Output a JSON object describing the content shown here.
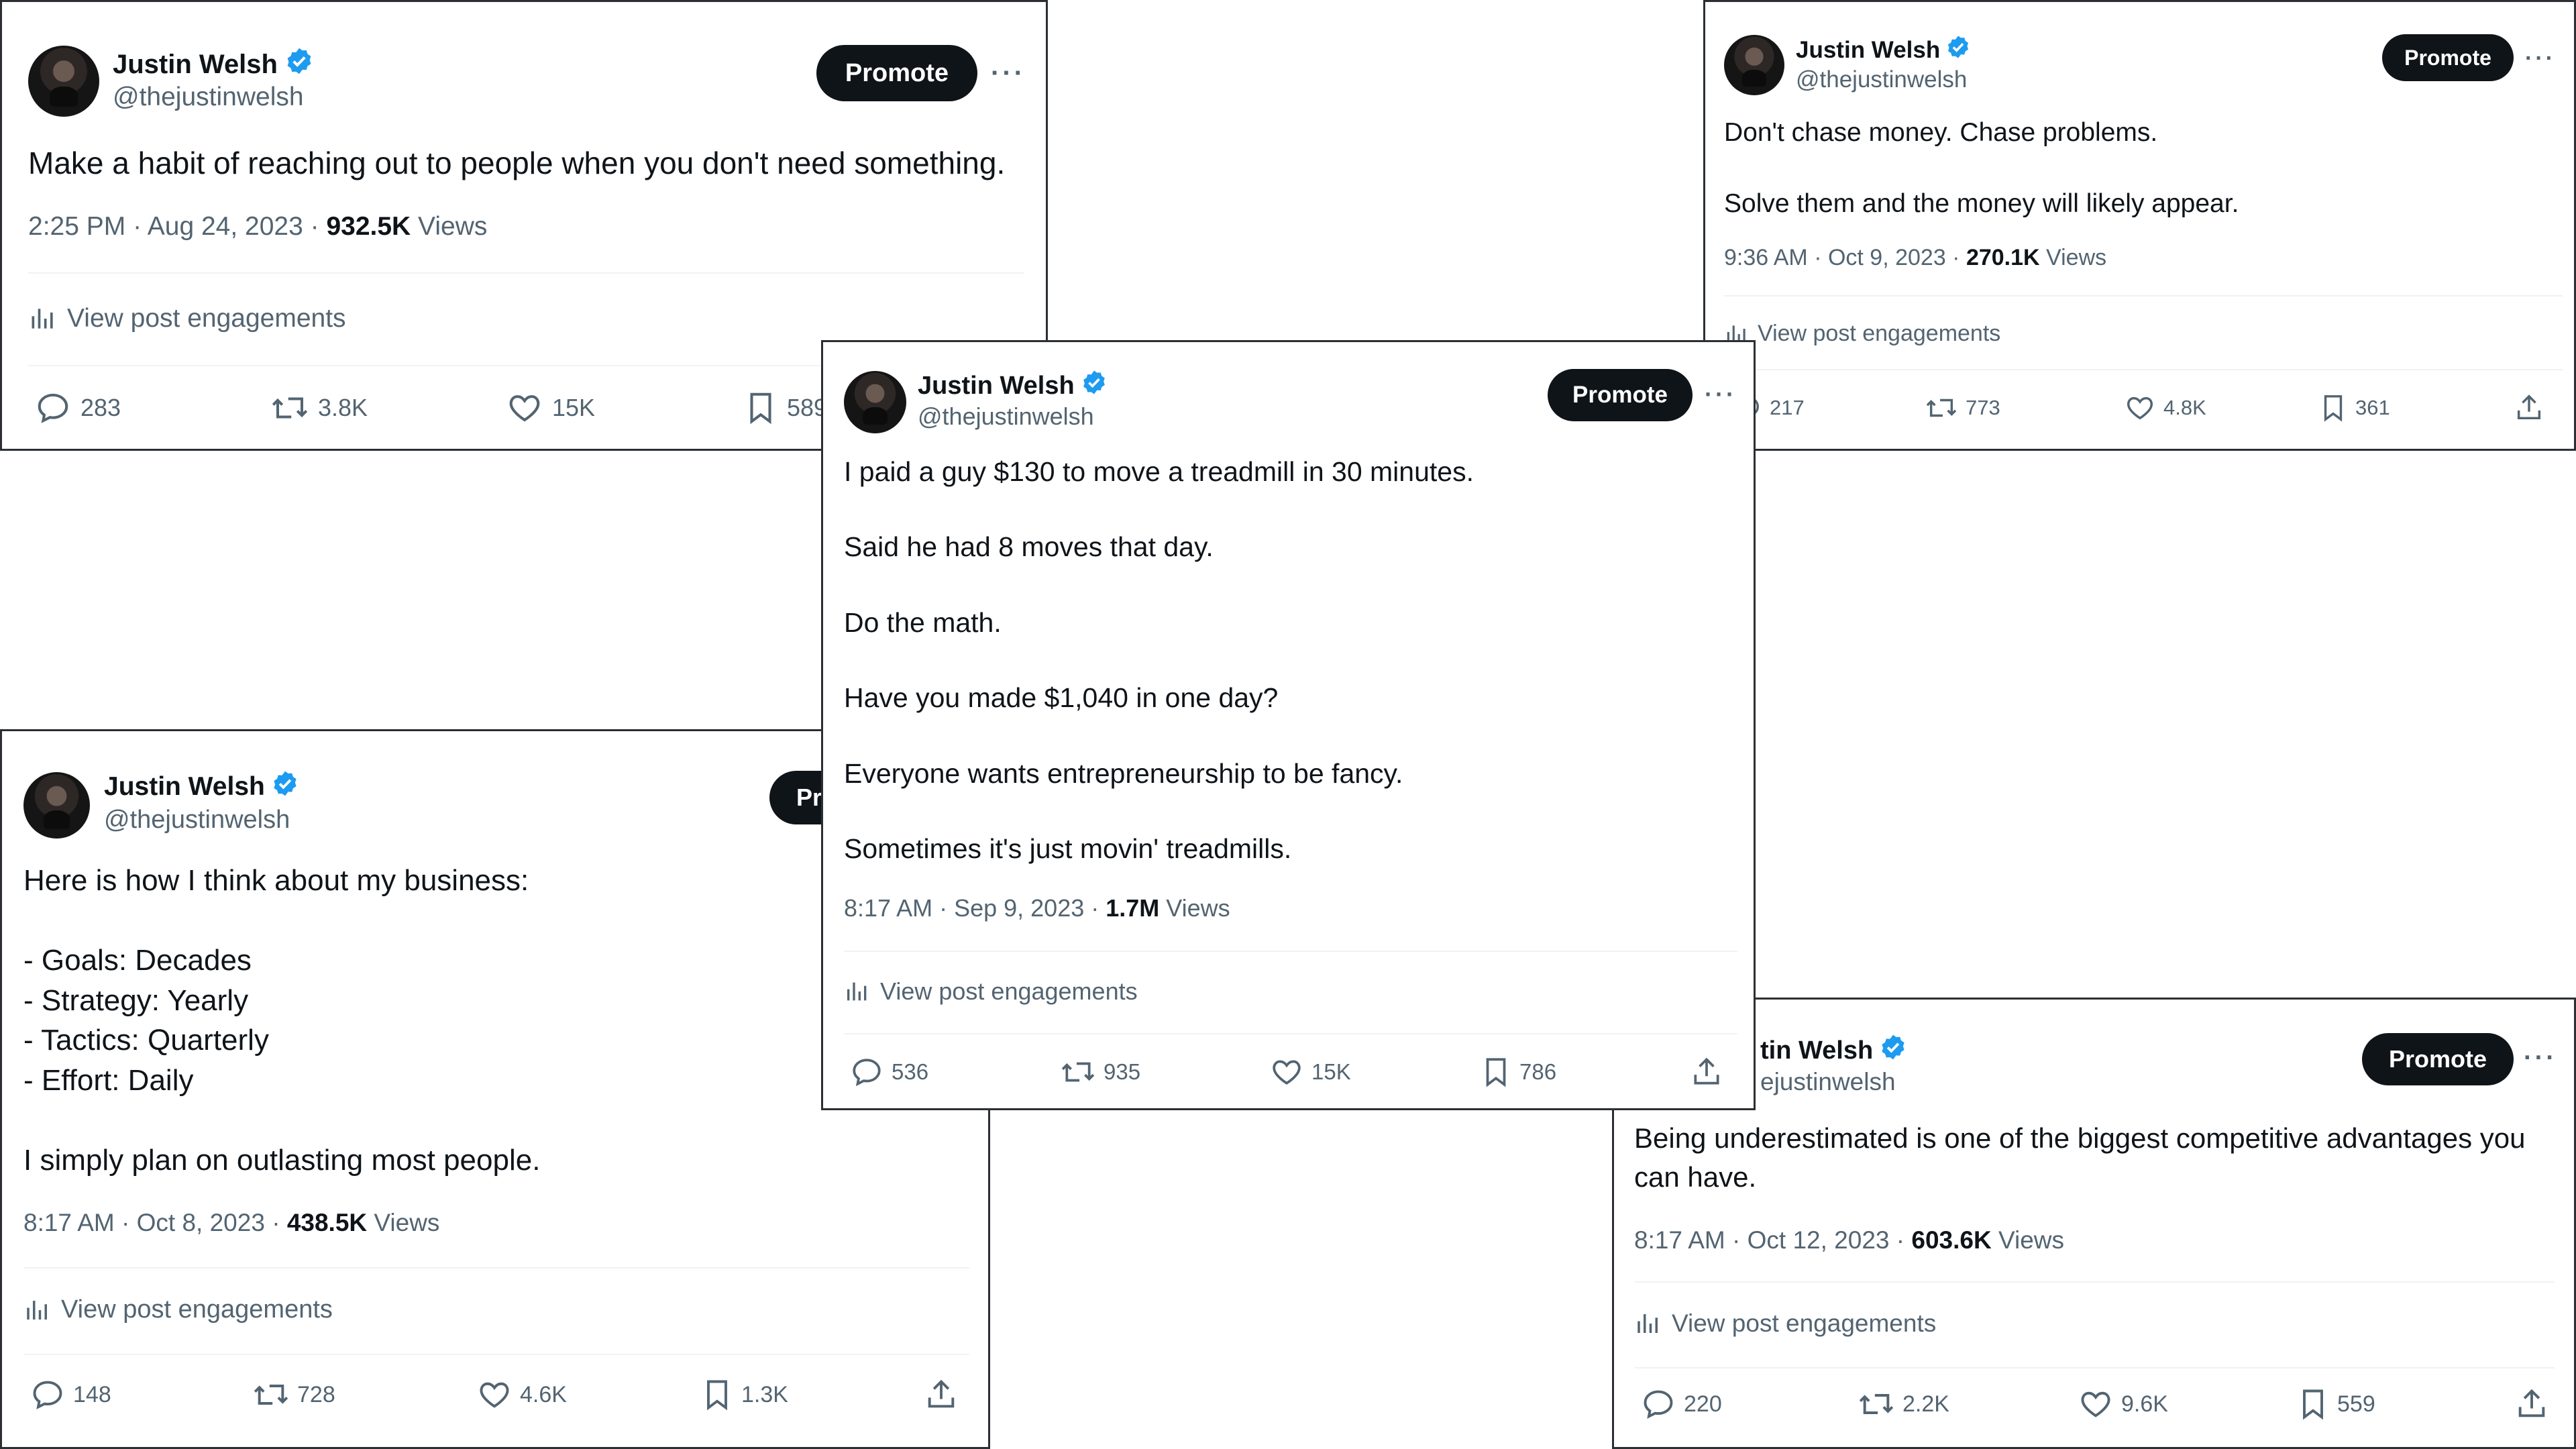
{
  "cards": {
    "tl": {
      "name": "Justin Welsh",
      "handle": "@thejustinwelsh",
      "promote": "Promote",
      "more": "···",
      "text": "Make a habit of reaching out to people when you don't need something.",
      "time": "2:25 PM · Aug 24, 2023 · ",
      "views": "932.5K",
      "views_label": " Views",
      "engagements": "View post engagements",
      "replies": "283",
      "reposts": "3.8K",
      "likes": "15K",
      "bookmarks": "589"
    },
    "tr": {
      "name": "Justin Welsh",
      "handle": "@thejustinwelsh",
      "promote": "Promote",
      "more": "···",
      "text": "Don't chase money. Chase problems.\n\nSolve them and the money will likely appear.",
      "time": "9:36 AM · Oct 9, 2023 · ",
      "views": "270.1K",
      "views_label": " Views",
      "engagements": "View post engagements",
      "replies": "217",
      "reposts": "773",
      "likes": "4.8K",
      "bookmarks": "361"
    },
    "center": {
      "name": "Justin Welsh",
      "handle": "@thejustinwelsh",
      "promote": "Promote",
      "more": "···",
      "text": "I paid a guy $130 to move a treadmill in 30 minutes.\n\nSaid he had 8 moves that day.\n\nDo the math.\n\nHave you made $1,040 in one day?\n\nEveryone wants entrepreneurship to be fancy.\n\nSometimes it's just movin' treadmills.",
      "time": "8:17 AM · Sep 9, 2023 · ",
      "views": "1.7M",
      "views_label": " Views",
      "engagements": "View post engagements",
      "replies": "536",
      "reposts": "935",
      "likes": "15K",
      "bookmarks": "786"
    },
    "bl": {
      "name": "Justin Welsh",
      "handle": "@thejustinwelsh",
      "promote": "Pr",
      "more": "",
      "text": "Here is how I think about my business:\n\n- Goals: Decades\n- Strategy: Yearly\n- Tactics: Quarterly\n- Effort: Daily\n\nI simply plan on outlasting most people.",
      "time": "8:17 AM · Oct 8, 2023 · ",
      "views": "438.5K",
      "views_label": " Views",
      "engagements": "View post engagements",
      "replies": "148",
      "reposts": "728",
      "likes": "4.6K",
      "bookmarks": "1.3K"
    },
    "br": {
      "name": "tin Welsh",
      "handle": "ejustinwelsh",
      "promote": "Promote",
      "more": "···",
      "text": "Being underestimated is one of the biggest competitive advantages you can have.",
      "time": "8:17 AM · Oct 12, 2023 · ",
      "views": "603.6K",
      "views_label": " Views",
      "engagements": "View post engagements",
      "replies": "220",
      "reposts": "2.2K",
      "likes": "9.6K",
      "bookmarks": "559"
    }
  },
  "colors": {
    "text": "#0f1419",
    "muted": "#536471",
    "verified": "#1d9bf0",
    "promote_bg": "#0f1419",
    "divider": "#eff3f4"
  },
  "icons": [
    "verified-badge-icon",
    "more-icon",
    "analytics-icon",
    "reply-icon",
    "repost-icon",
    "like-icon",
    "bookmark-icon",
    "share-icon"
  ]
}
